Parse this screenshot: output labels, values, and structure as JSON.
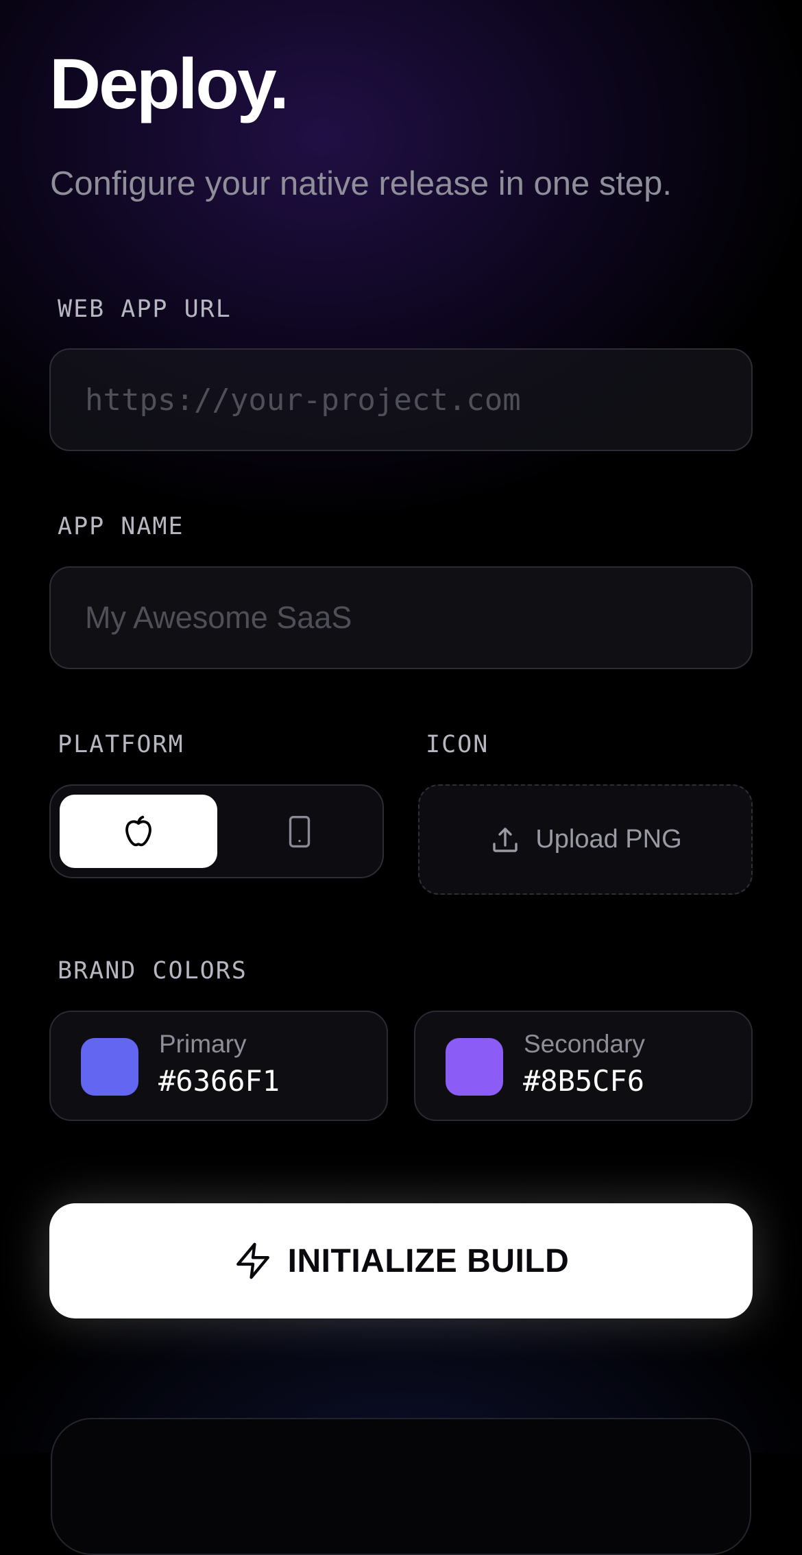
{
  "header": {
    "title": "Deploy.",
    "subtitle": "Configure your native release in one step."
  },
  "form": {
    "url": {
      "label": "WEB APP URL",
      "value": "",
      "placeholder": "https://your-project.com"
    },
    "name": {
      "label": "APP NAME",
      "value": "",
      "placeholder": "My Awesome SaaS"
    },
    "platform": {
      "label": "PLATFORM",
      "options": [
        {
          "id": "ios",
          "icon": "apple-icon",
          "selected": true
        },
        {
          "id": "android",
          "icon": "phone-icon",
          "selected": false
        }
      ]
    },
    "icon": {
      "label": "ICON",
      "upload_label": "Upload PNG",
      "upload_icon": "upload-icon"
    },
    "brand_colors": {
      "label": "BRAND COLORS",
      "primary": {
        "name": "Primary",
        "hex": "#6366F1"
      },
      "secondary": {
        "name": "Secondary",
        "hex": "#8B5CF6"
      }
    }
  },
  "actions": {
    "build_label": "INITIALIZE BUILD",
    "build_icon": "lightning-icon"
  }
}
